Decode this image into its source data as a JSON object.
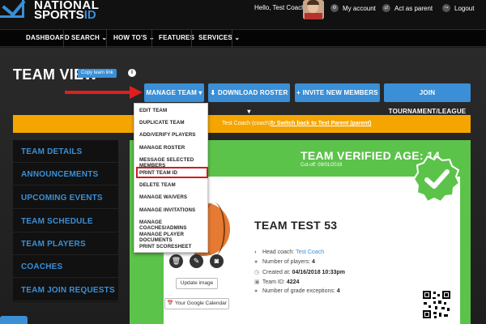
{
  "header": {
    "logo_line1": "NATIONAL",
    "logo_line2": "SPORTS",
    "logo_id": "ID",
    "greeting": "Hello, Test Coach",
    "my_account": "My account",
    "act_as_parent": "Act as parent",
    "logout": "Logout"
  },
  "nav": {
    "items": [
      "DASHBOARD",
      "SEARCH ⌄",
      "HOW TO'S ⌄",
      "FEATURES",
      "SERVICES ⌄"
    ]
  },
  "page": {
    "title": "TEAM VIEW",
    "copy_link": "Copy team link",
    "info": "i"
  },
  "buttons": {
    "manage_team": "MANAGE TEAM ▾",
    "download_roster": "⬇ DOWNLOAD ROSTER ▾",
    "invite": "+ INVITE NEW MEMBERS",
    "join": "JOIN TOURNAMENT/LEAGUE"
  },
  "banner": {
    "text": "Test Coach (coach).",
    "switch_link": "↻ Switch back to Test Parent (parent)"
  },
  "dropdown": {
    "items": [
      "EDIT TEAM",
      "DUPLICATE TEAM",
      "ADD/VERIFY PLAYERS",
      "MANAGE ROSTER",
      "MESSAGE SELECTED MEMBERS",
      "PRINT TEAM ID",
      "DELETE TEAM",
      "MANAGE WAIVERS",
      "MANAGE INVITATIONS",
      "MANAGE COACHES/ADMINS",
      "MANAGE PLAYER DOCUMENTS",
      "PRINT SCORESHEET"
    ],
    "highlighted_index": 5
  },
  "sidebar": {
    "items": [
      "TEAM DETAILS",
      "ANNOUNCEMENTS",
      "UPCOMING EVENTS",
      "TEAM SCHEDULE",
      "TEAM PLAYERS",
      "COACHES",
      "TEAM JOIN REQUESTS"
    ]
  },
  "team": {
    "verified_age": "TEAM VERIFIED AGE: 14",
    "cutoff": "Cut-off: 09/01/2019",
    "name": "TEAM TEST 53",
    "head_coach_label": "Head coach:",
    "head_coach": "Test Coach",
    "players_label": "Number of players:",
    "players": "4",
    "created_label": "Created at:",
    "created": "04/16/2018 10:33pm",
    "team_id_label": "Team ID:",
    "team_id": "4224",
    "exceptions_label": "Number of grade exceptions:",
    "exceptions": "4",
    "update_image": "Update image",
    "google_calendar": "Your Google Calendar"
  },
  "colors": {
    "accent": "#3a8fd6",
    "banner": "#f5a500",
    "card_green": "#5cc34a",
    "highlight_red": "#d21c1c"
  }
}
